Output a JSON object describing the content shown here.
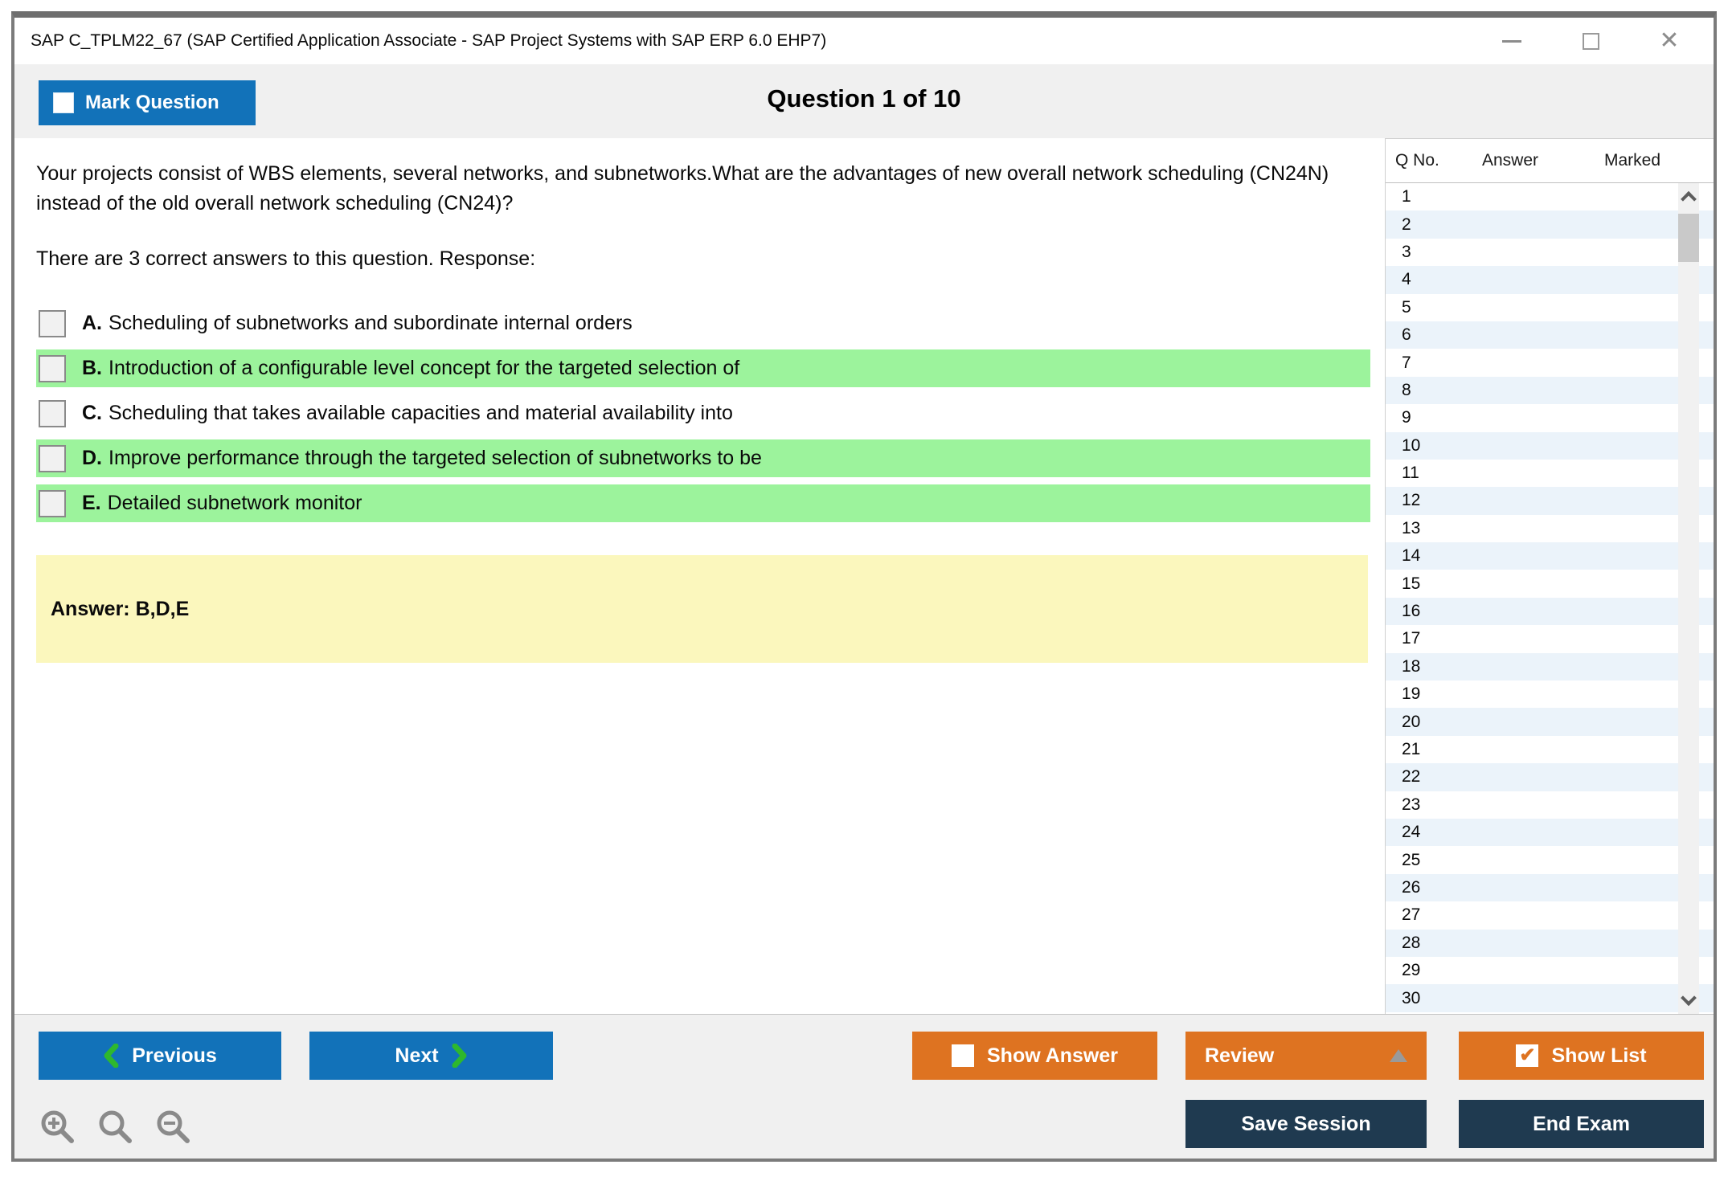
{
  "window": {
    "title": "SAP C_TPLM22_67 (SAP Certified Application Associate - SAP Project Systems with SAP ERP 6.0 EHP7)"
  },
  "header": {
    "mark_question_label": "Mark Question",
    "question_counter": "Question 1 of 10"
  },
  "question": {
    "text": "Your projects consist of WBS elements, several networks, and subnetworks.What are the advantages of new overall network scheduling (CN24N) instead of the old overall network scheduling (CN24)?",
    "instruction": "There are 3 correct answers to this question. Response:",
    "options": [
      {
        "letter": "A.",
        "text": "Scheduling of subnetworks and subordinate internal orders",
        "highlighted": false
      },
      {
        "letter": "B.",
        "text": "Introduction of a configurable level concept for the targeted selection of",
        "highlighted": true
      },
      {
        "letter": "C.",
        "text": "Scheduling that takes available capacities and material availability into",
        "highlighted": false
      },
      {
        "letter": "D.",
        "text": "Improve performance through the targeted selection of subnetworks to be",
        "highlighted": true
      },
      {
        "letter": "E.",
        "text": "Detailed subnetwork monitor",
        "highlighted": true
      }
    ],
    "answer_label": "Answer: B,D,E"
  },
  "question_list": {
    "columns": {
      "qno": "Q No.",
      "answer": "Answer",
      "marked": "Marked"
    },
    "rows": [
      1,
      2,
      3,
      4,
      5,
      6,
      7,
      8,
      9,
      10,
      11,
      12,
      13,
      14,
      15,
      16,
      17,
      18,
      19,
      20,
      21,
      22,
      23,
      24,
      25,
      26,
      27,
      28,
      29,
      30
    ]
  },
  "footer": {
    "previous_label": "Previous",
    "next_label": "Next",
    "show_answer_label": "Show Answer",
    "review_label": "Review",
    "show_list_label": "Show List",
    "save_session_label": "Save Session",
    "end_exam_label": "End Exam"
  },
  "colors": {
    "accent_blue": "#1272b9",
    "accent_orange": "#de7321",
    "accent_navy": "#1f3a50",
    "highlight_green": "#9cf39c",
    "answer_yellow": "#fbf7bd",
    "stripe_blue": "#ebf3fa",
    "chevron_green": "#2eb82e"
  }
}
